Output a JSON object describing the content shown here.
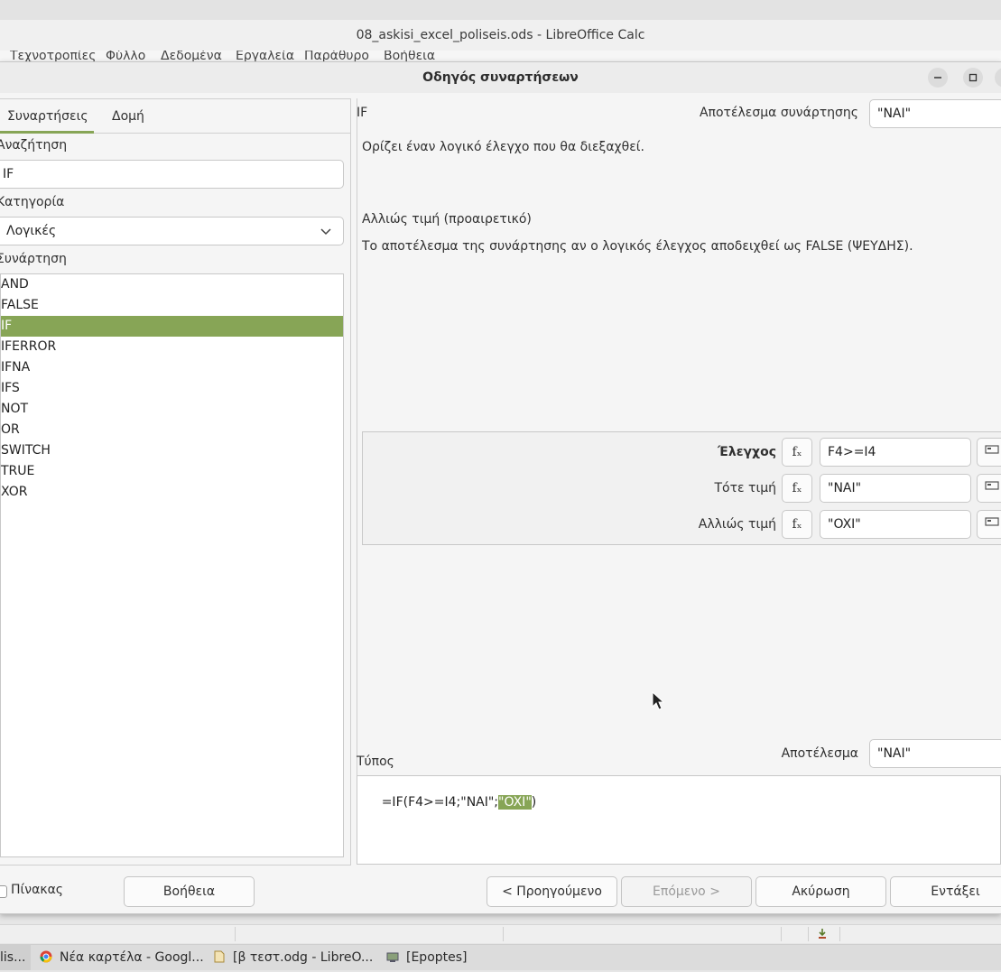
{
  "window": {
    "title": "08_askisi_excel_poliseis.ods - LibreOffice Calc",
    "menu": [
      "Τεχνοτροπίες",
      "Φύλλο",
      "Δεδομένα",
      "Εργαλεία",
      "Παράθυρο",
      "Βοήθεια"
    ]
  },
  "dialog": {
    "title": "Οδηγός συναρτήσεων",
    "tabs": [
      "Συναρτήσεις",
      "Δομή"
    ],
    "search_label": "Αναζήτηση",
    "search_value": "IF",
    "category_label": "Κατηγορία",
    "category_value": "Λογικές",
    "function_label": "Συνάρτηση",
    "functions": [
      "AND",
      "FALSE",
      "IF",
      "IFERROR",
      "IFNA",
      "IFS",
      "NOT",
      "OR",
      "SWITCH",
      "TRUE",
      "XOR"
    ],
    "selected_function": "IF",
    "function_name": "IF",
    "function_result_label": "Αποτέλεσμα συνάρτησης",
    "function_result_value": "\"NAI\"",
    "description": "Ορίζει έναν λογικό έλεγχο που θα διεξαχθεί.",
    "arg_title": "Αλλιώς τιμή (προαιρετικό)",
    "arg_description": "Το αποτέλεσμα της συνάρτησης αν ο λογικός έλεγχος αποδειχθεί ως FALSE (ΨΕΥΔΗΣ).",
    "args": [
      {
        "label": "Έλεγχος",
        "value": "F4>=I4",
        "bold": true
      },
      {
        "label": "Τότε τιμή",
        "value": "\"NAI\"",
        "bold": false
      },
      {
        "label": "Αλλιώς τιμή",
        "value": "\"OXI\"",
        "bold": false
      }
    ],
    "fx_symbol": "fₓ",
    "formula_label": "Τύπος",
    "result_label": "Αποτέλεσμα",
    "result_value": "\"NAI\"",
    "formula_prefix": "=IF(F4>=I4;\"NAI\";",
    "formula_highlight": "\"OXI\"",
    "formula_suffix": ")",
    "buttons": {
      "array": "Πίνακας",
      "help": "Βοήθεια",
      "back": "< Προηγούμενο",
      "next": "Επόμενο >",
      "cancel": "Ακύρωση",
      "ok": "Εντάξει"
    }
  },
  "taskbar": {
    "items": [
      "lis...",
      "Νέα καρτέλα - Googl...",
      "[β τεστ.odg - LibreO...",
      "[Epoptes]"
    ]
  },
  "colors": {
    "accent": "#87a556"
  }
}
